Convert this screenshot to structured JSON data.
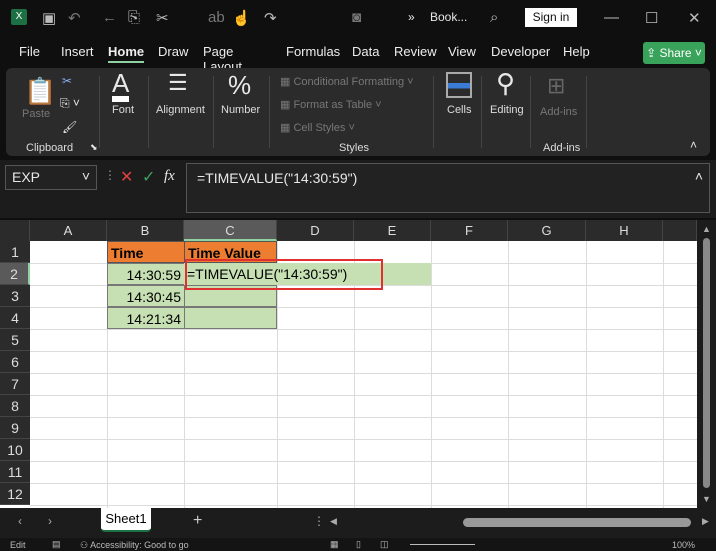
{
  "titlebar": {
    "app_icon": "excel-icon",
    "title": "Book...",
    "signin": "Sign in",
    "overflow": "»"
  },
  "menu": {
    "tabs": [
      "File",
      "Insert",
      "Home",
      "Draw",
      "Page Layout",
      "Formulas",
      "Data",
      "Review",
      "View",
      "Developer",
      "Help"
    ],
    "active": "Home",
    "share": "Share"
  },
  "ribbon": {
    "paste": "Paste",
    "clipboard": "Clipboard",
    "font": "Font",
    "alignment": "Alignment",
    "number": "Number",
    "conditional_formatting": "Conditional Formatting",
    "format_as_table": "Format as Table",
    "cell_styles": "Cell Styles",
    "styles": "Styles",
    "cells": "Cells",
    "editing": "Editing",
    "addins_btn": "Add-ins",
    "addins_group": "Add-ins"
  },
  "formula_bar": {
    "name_box": "EXP",
    "fx": "fx",
    "formula": "=TIMEVALUE(\"14:30:59\")"
  },
  "grid": {
    "columns": [
      "A",
      "B",
      "C",
      "D",
      "E",
      "F",
      "G",
      "H"
    ],
    "rows": [
      "1",
      "2",
      "3",
      "4",
      "5",
      "6",
      "7",
      "8",
      "9",
      "10",
      "11",
      "12"
    ],
    "cells": {
      "B1": "Time",
      "C1": "Time Value",
      "B2": "14:30:59",
      "C2": "=TIMEVALUE(\"14:30:59\")",
      "B3": "14:30:45",
      "B4": "14:21:34"
    }
  },
  "colors": {
    "header_fill": "#ED7D31",
    "data_fill": "#C6E0B4",
    "highlight_box": "#E03030",
    "accent": "#3AA35B"
  },
  "sheets": {
    "tabs": [
      "Sheet1"
    ],
    "add": "+"
  },
  "status": {
    "mode": "Edit",
    "accessibility": "Accessibility: Good to go",
    "zoom": "100%"
  }
}
